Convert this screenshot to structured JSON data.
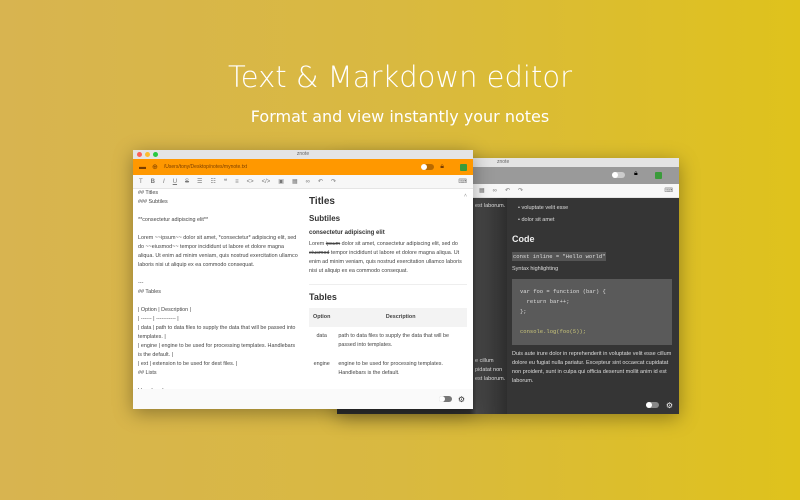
{
  "hero": {
    "title": "Text & Markdown editor",
    "subtitle": "Format and view instantly your notes"
  },
  "app_title": "znote",
  "front": {
    "path": "/Users/tony/Desktop/notes/mynote.txt",
    "editor_lines": [
      "## Titles",
      "### Subtiles",
      "",
      "**consectetur adipiscing elit**",
      "",
      "Lorem ~~ipsum~~ dolor sit amet, *consectetur* adipiscing elit, sed do ~~eiusmod~~ tempor incididunt ut labore et dolore magna aliqua. Ut enim ad minim veniam, quis nostrud exercitation ullamco laboris nisi ut aliquip ex ea commodo consequat.",
      "",
      "---",
      "## Tables",
      "",
      "| Option | Description |",
      "| ------ | ----------- |",
      "| data   | path to data files to supply the data that will be passed into templates. |",
      "| engine | engine to be used for processing templates. Handlebars is the default. |",
      "| ext    | extension to be used for dest files. |",
      "## Lists",
      "",
      "Unordered"
    ],
    "preview": {
      "h1": "Titles",
      "h2": "Subtiles",
      "h3": "consectetur adipiscing elit",
      "para_pre": "Lorem ",
      "strike1": "ipsum",
      "para_mid": " dolor sit amet, consectetur adipiscing elit, sed do ",
      "strike2": "eiusmod",
      "para_post": " tempor incididunt ut labore et dolore magna aliqua. Ut enim ad minim veniam, quis nostrud exercitation ullamco laboris nisi ut aliquip ex ea commodo consequat.",
      "tables_heading": "Tables",
      "table_headers": [
        "Option",
        "Description"
      ],
      "rows": [
        [
          "data",
          "path to data files to supply the data that will be passed into templates."
        ],
        [
          "engine",
          "engine to be used for processing templates. Handlebars is the default."
        ]
      ]
    }
  },
  "back": {
    "left_lines": [
      "est laborum.",
      "e cillum",
      "pidatat non",
      "est laborum."
    ],
    "bullets": [
      "voluptate velit esse",
      "dolor sit amet"
    ],
    "code_heading": "Code",
    "inline_code": "const inline = \"Hello world\"",
    "syntax_label": "Syntax highlighting",
    "code_lines": [
      "var foo = function (bar) {",
      "  return bar++;",
      "};",
      "",
      "console.log(foo(5));"
    ],
    "paragraph": "Duis aute irure dolor in reprehenderit in voluptate velit esse cillum dolore eu fugiat nulla pariatur. Excepteur sint occaecat cupidatat non proident, sunt in culpa qui officia deserunt mollit anim id est laborum."
  }
}
